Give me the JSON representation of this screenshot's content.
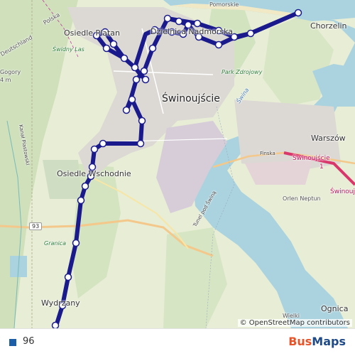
{
  "map": {
    "place_labels": {
      "north_beach": "Pomorskie",
      "chorzelin": "Chorzelin",
      "osiedle_platan": "Osiedle Platan",
      "polska": "Polska",
      "deutschland": "Deutschland",
      "swidny_las": "Świdny Las",
      "zdroj": "Dzielnica Nadmorska",
      "park_zdrojowy": "Park Zdrojowy",
      "city": "Świnoujście",
      "warszow": "Warszów",
      "swinoujscie_station": "Świnoujście",
      "station_1": "1",
      "finska": "Finska",
      "osiedle_wschodnie": "Osiedle Wschodnie",
      "orlen_neptun": "Orlen Neptun",
      "road_93": "93",
      "gogory": "Gogory",
      "gogory_sub": "4 m",
      "tunel": "Tunel pod Świną",
      "granica": "Granica",
      "wydrzany": "Wydrzany",
      "ognica": "Ognica",
      "kanal": "Kanał Piastowski",
      "swina": "Świna",
      "wielki": "Wielki",
      "swinoujscie_right": "Świnouj"
    },
    "route_color": "#1a1a8c",
    "attribution": "© OpenStreetMap contributors"
  },
  "legend": {
    "route_name": "96",
    "swatch_color": "#1d5ea8"
  },
  "brand": {
    "part1": "Bus",
    "part2": "Maps"
  }
}
